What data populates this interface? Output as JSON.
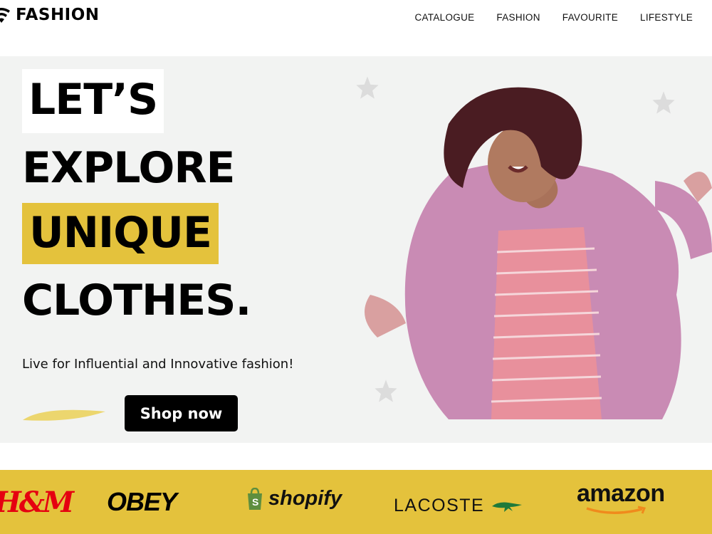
{
  "header": {
    "logo_text": "FASHION",
    "nav": [
      "CATALOGUE",
      "FASHION",
      "FAVOURITE",
      "LIFESTYLE"
    ]
  },
  "hero": {
    "headline": [
      "LET’S",
      "EXPLORE",
      "UNIQUE",
      "CLOTHES."
    ],
    "tagline": "Live for Influential and Innovative fashion!",
    "cta_label": "Shop now",
    "accent_color": "#e4c23c",
    "background_color": "#f2f3f2"
  },
  "brands": {
    "items": [
      "H&M",
      "OBEY",
      "shopify",
      "LACOSTE",
      "amazon"
    ],
    "background_color": "#e4c23c"
  }
}
